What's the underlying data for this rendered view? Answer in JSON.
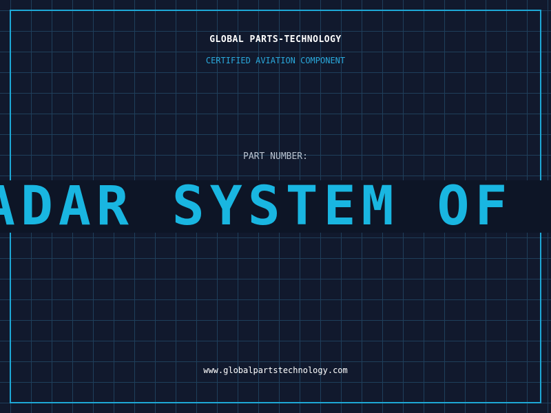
{
  "header": {
    "brand": "GLOBAL PARTS-TECHNOLOGY",
    "subtitle": "CERTIFIED AVIATION COMPONENT"
  },
  "part": {
    "label": "PART NUMBER:",
    "value": "ADAR SYSTEM OF INDI"
  },
  "footer": {
    "website": "www.globalpartstechnology.com"
  },
  "colors": {
    "background": "#11192d",
    "grid": "#1f3f5b",
    "accent": "#1ea8d6",
    "banner_background": "#0d1526",
    "banner_text": "#19b6e1"
  }
}
